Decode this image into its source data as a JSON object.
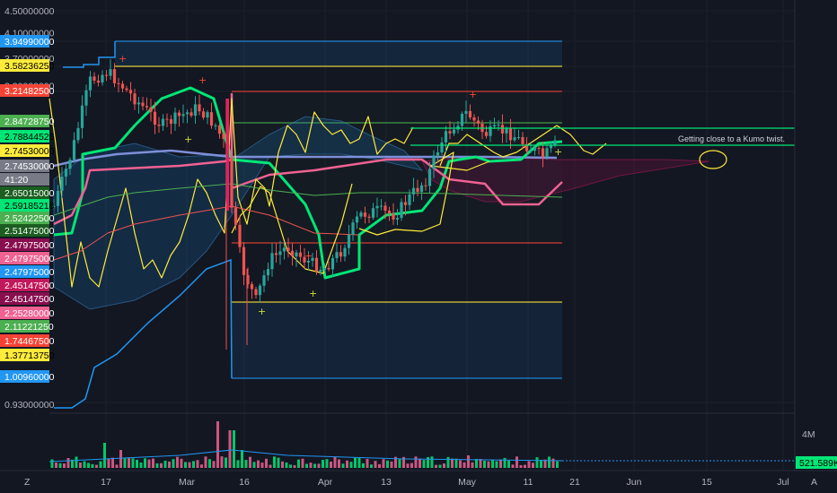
{
  "chart_data": {
    "type": "candlestick",
    "price_axis_ticks": [
      {
        "label": "4.50000000",
        "y_value": 4.5
      },
      {
        "label": "4.10000000",
        "y_value": 4.1
      },
      {
        "label": "3.70000000",
        "y_value": 3.7
      },
      {
        "label": "3.30000000",
        "y_value": 3.3
      },
      {
        "label": "0.93000000",
        "y_value": 0.93
      }
    ],
    "price_labels": [
      {
        "label": "3.94990000",
        "value": 3.9499,
        "color": "#2196f3",
        "text": "light"
      },
      {
        "label": "3.58236250",
        "value": 3.5824,
        "color": "#ffeb3b",
        "text": "dark"
      },
      {
        "label": "3.21482500",
        "value": 3.2148,
        "color": "#f44336",
        "text": "light"
      },
      {
        "label": "2.84728750",
        "value": 2.8473,
        "color": "#4caf50",
        "text": "light"
      },
      {
        "label": "2.78844525",
        "value": 2.7884,
        "color": "#00e676",
        "text": "dark"
      },
      {
        "label": "2.74530000",
        "value": 2.7453,
        "color": "#ffeb3b",
        "text": "dark"
      },
      {
        "label": "2.74530000",
        "value": 2.7453,
        "color": "#787b86",
        "text": "light"
      },
      {
        "label": "41:20",
        "value": 2.7049,
        "color": "#787b86",
        "text": "light"
      },
      {
        "label": "2.65015000",
        "value": 2.6502,
        "color": "#1b5e20",
        "text": "light"
      },
      {
        "label": "2.59185218",
        "value": 2.5919,
        "color": "#00e676",
        "text": "dark"
      },
      {
        "label": "2.52422500",
        "value": 2.5242,
        "color": "#4caf50",
        "text": "light"
      },
      {
        "label": "2.51475000",
        "value": 2.5148,
        "color": "#1b5e20",
        "text": "light"
      },
      {
        "label": "2.47975000",
        "value": 2.4798,
        "color": "#880e4f",
        "text": "light"
      },
      {
        "label": "2.47975000",
        "value": 2.4798,
        "color": "#f06292",
        "text": "light"
      },
      {
        "label": "2.47975000",
        "value": 2.4798,
        "color": "#2196f3",
        "text": "light"
      },
      {
        "label": "2.45147500",
        "value": 2.4515,
        "color": "#c2185b",
        "text": "light"
      },
      {
        "label": "2.45147500",
        "value": 2.4515,
        "color": "#880e4f",
        "text": "light"
      },
      {
        "label": "2.25280000",
        "value": 2.2528,
        "color": "#f06292",
        "text": "light"
      },
      {
        "label": "2.11221250",
        "value": 2.1122,
        "color": "#4caf50",
        "text": "light"
      },
      {
        "label": "1.74467500",
        "value": 1.7447,
        "color": "#f44336",
        "text": "light"
      },
      {
        "label": "1.37713750",
        "value": 1.3771,
        "color": "#ffeb3b",
        "text": "dark"
      },
      {
        "label": "1.00960000",
        "value": 1.0096,
        "color": "#2196f3",
        "text": "light"
      }
    ],
    "time_axis": [
      "17",
      "Mar",
      "16",
      "Apr",
      "13",
      "May",
      "11",
      "21",
      "Jun",
      "15",
      "Jul"
    ],
    "volume_axis": {
      "tick": "4M",
      "last_label": "521.589K",
      "last_color": "#00e676"
    },
    "annotation": "Getting close to a Kumo twist.",
    "corner_buttons": {
      "left": "Z",
      "right": "A"
    },
    "series": [
      {
        "kind": "fib-level",
        "value": 3.9499,
        "color": "#2196f3"
      },
      {
        "kind": "fib-level",
        "value": 3.5824,
        "color": "#ffeb3b"
      },
      {
        "kind": "fib-level",
        "value": 3.2148,
        "color": "#f44336"
      },
      {
        "kind": "fib-level",
        "value": 2.4798,
        "color": "#f44336"
      },
      {
        "kind": "fib-level",
        "value": 1.3771,
        "color": "#ffeb3b"
      },
      {
        "kind": "fib-level",
        "value": 1.0096,
        "color": "#2196f3"
      }
    ]
  },
  "colors": {
    "background": "#131722",
    "grid": "#1e222d",
    "bull": "#26a69a",
    "bear": "#ef5350",
    "kijun": "#00e676",
    "tenkan": "#f06292",
    "lagging": "#ffeb3b",
    "base": "#7e8fd9"
  }
}
